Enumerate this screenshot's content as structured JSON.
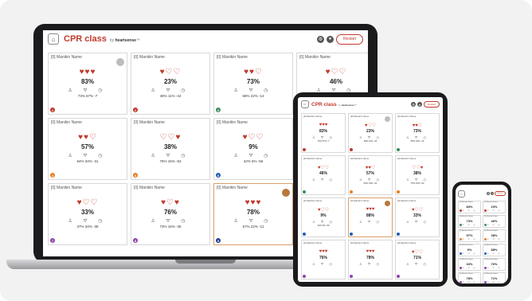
{
  "app": {
    "title": "CPR class",
    "by": "by ",
    "brand": "heartsense",
    "trademark": "™",
    "restart_label": "Restart",
    "logo_glyph": "⌂",
    "header_icon_1": "⚙",
    "header_icon_2": "●"
  },
  "icons": {
    "heart_full": "♥",
    "heart_empty": "♡",
    "metric_icons": "♙ ⛛ ◷"
  },
  "colors": {
    "brand_red": "#c0392b",
    "dot_colors": [
      "#c0392b",
      "#e67e22",
      "#3d8b5c",
      "#1f5fb4",
      "#8e44ad"
    ]
  },
  "laptop": {
    "cards": [
      {
        "name": "[0] Manikin Name",
        "hearts": "♥♥♥",
        "pct": "83%",
        "stats": "73%   57%   -7",
        "dot": "1",
        "dot_color": "#c0392b",
        "avatar": "gray"
      },
      {
        "name": "[0] Manikin Name",
        "hearts": "♥♡♡",
        "pct": "23%",
        "stats": "48%   11%   -44",
        "dot": "2",
        "dot_color": "#c0392b",
        "avatar": ""
      },
      {
        "name": "[0] Manikin Name",
        "hearts": "♥♥♡",
        "pct": "73%",
        "stats": "68%   22%   -14",
        "dot": "3",
        "dot_color": "#3d8b5c",
        "avatar": ""
      },
      {
        "name": "[0] Manikin Name",
        "hearts": "♥♡♡",
        "pct": "46%",
        "stats": "",
        "dot": "",
        "dot_color": "#3d8b5c",
        "avatar": ""
      },
      {
        "name": "[0] Manikin Name",
        "hearts": "♥♥♡",
        "pct": "57%",
        "stats": "64%   34%   -31",
        "dot": "4",
        "dot_color": "#e67e22",
        "avatar": ""
      },
      {
        "name": "[0] Manikin Name",
        "hearts": "♡♡♥",
        "pct": "38%",
        "stats": "75%   15%   -53",
        "dot": "5",
        "dot_color": "#e67e22",
        "avatar": ""
      },
      {
        "name": "[0] Manikin Name",
        "hearts": "♥♡♡",
        "pct": "9%",
        "stats": "42%   5%   -56",
        "dot": "6",
        "dot_color": "#1f5fb4",
        "avatar": ""
      },
      {
        "name": "[0] Manikin Name",
        "hearts": "",
        "pct": "",
        "stats": "",
        "dot": "",
        "dot_color": "#1f5fb4",
        "avatar": ""
      },
      {
        "name": "[0] Manikin Name",
        "hearts": "♥♡♡",
        "pct": "33%",
        "stats": "37%   34%   -38",
        "dot": "7",
        "dot_color": "#8e44ad",
        "avatar": ""
      },
      {
        "name": "[0] Manikin Name",
        "hearts": "♥♡♥",
        "pct": "76%",
        "stats": "73%   15%   -36",
        "dot": "8",
        "dot_color": "#8e44ad",
        "avatar": ""
      },
      {
        "name": "[0] Manikin Name",
        "hearts": "♥♥♥",
        "pct": "78%",
        "stats": "67%   22%   -11",
        "dot": "9",
        "dot_color": "#1f3f8f",
        "avatar": "brown",
        "selected": true
      },
      {
        "name": "[0] Manikin Name",
        "hearts": "",
        "pct": "",
        "stats": "",
        "dot": "",
        "dot_color": "#8e44ad",
        "avatar": ""
      }
    ]
  },
  "tablet": {
    "cards": [
      {
        "name": "[0] Manikin Name",
        "hearts": "♥♥♥",
        "pct": "83%",
        "stats": "73%  57%  -7",
        "dot": "",
        "dot_color": "#c0392b",
        "avatar": ""
      },
      {
        "name": "[0] Manikin Name",
        "hearts": "♥♡♡",
        "pct": "23%",
        "stats": "48%  11%  -44",
        "dot": "",
        "dot_color": "#c0392b",
        "avatar": "gray"
      },
      {
        "name": "[0] Manikin Name",
        "hearts": "♥♥♡",
        "pct": "73%",
        "stats": "68%  22%  -14",
        "dot": "",
        "dot_color": "#3d8b5c",
        "avatar": ""
      },
      {
        "name": "[0] Manikin Name",
        "hearts": "♥♡♡",
        "pct": "46%",
        "stats": "",
        "dot": "",
        "dot_color": "#3d8b5c",
        "avatar": ""
      },
      {
        "name": "[0] Manikin Name",
        "hearts": "♥♥♡",
        "pct": "57%",
        "stats": "64%  34%  -31",
        "dot": "",
        "dot_color": "#e67e22",
        "avatar": ""
      },
      {
        "name": "[0] Manikin Name",
        "hearts": "♡♡♥",
        "pct": "38%",
        "stats": "75%  15%  -53",
        "dot": "",
        "dot_color": "#e67e22",
        "avatar": ""
      },
      {
        "name": "[0] Manikin Name",
        "hearts": "♥♡♡",
        "pct": "9%",
        "stats": "42%  5%  -56",
        "dot": "",
        "dot_color": "#1f5fb4",
        "avatar": ""
      },
      {
        "name": "[0] Manikin Name",
        "hearts": "♥♥♥",
        "pct": "88%",
        "stats": "",
        "dot": "",
        "dot_color": "#1f5fb4",
        "avatar": "brown",
        "selected": true
      },
      {
        "name": "[0] Manikin Name",
        "hearts": "♥♡♡",
        "pct": "33%",
        "stats": "",
        "dot": "",
        "dot_color": "#1f5fb4",
        "avatar": ""
      },
      {
        "name": "[0] Manikin Name",
        "hearts": "♥♥♥",
        "pct": "76%",
        "stats": "",
        "dot": "",
        "dot_color": "#8e44ad",
        "avatar": ""
      },
      {
        "name": "[0] Manikin Name",
        "hearts": "♥♥♥",
        "pct": "78%",
        "stats": "",
        "dot": "",
        "dot_color": "#8e44ad",
        "avatar": ""
      },
      {
        "name": "[0] Manikin Name",
        "hearts": "♥♡♡",
        "pct": "71%",
        "stats": "",
        "dot": "",
        "dot_color": "#8e44ad",
        "avatar": ""
      }
    ]
  },
  "phone": {
    "cards": [
      {
        "name": "[0] Manikin Name",
        "pct": "83%",
        "dot": "",
        "dot_color": "#c0392b"
      },
      {
        "name": "[0] Manikin Name",
        "pct": "23%",
        "dot": "",
        "dot_color": "#c0392b"
      },
      {
        "name": "[0] Manikin Name",
        "pct": "73%",
        "dot": "",
        "dot_color": "#3d8b5c"
      },
      {
        "name": "[0] Manikin Name",
        "pct": "46%",
        "dot": "",
        "dot_color": "#3d8b5c"
      },
      {
        "name": "[0] Manikin Name",
        "pct": "57%",
        "dot": "",
        "dot_color": "#e67e22"
      },
      {
        "name": "[0] Manikin Name",
        "pct": "38%",
        "dot": "",
        "dot_color": "#e67e22"
      },
      {
        "name": "[0] Manikin Name",
        "pct": "9%",
        "dot": "",
        "dot_color": "#1f5fb4"
      },
      {
        "name": "[0] Manikin Name",
        "pct": "88%",
        "dot": "",
        "dot_color": "#1f5fb4"
      },
      {
        "name": "[0] Manikin Name",
        "pct": "33%",
        "dot": "",
        "dot_color": "#8e44ad"
      },
      {
        "name": "[0] Manikin Name",
        "pct": "76%",
        "dot": "",
        "dot_color": "#8e44ad"
      },
      {
        "name": "[0] Manikin Name",
        "pct": "78%",
        "dot": "",
        "dot_color": "#8e44ad"
      },
      {
        "name": "[0] Manikin Name",
        "pct": "71%",
        "dot": "",
        "dot_color": "#8e44ad"
      }
    ]
  }
}
